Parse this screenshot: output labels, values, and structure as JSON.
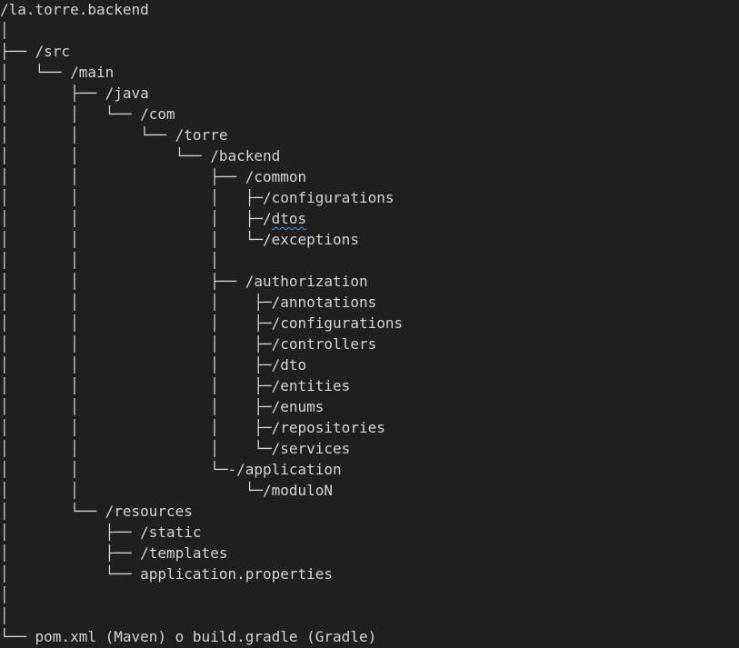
{
  "tree_lines": [
    "/la.torre.backend",
    "│",
    "├── /src",
    "│   └── /main",
    "│       ├── /java",
    "│       │   └── /com",
    "│       │       └── /torre",
    "│       │           └── /backend",
    "│       │               ├── /common",
    "│       │               │   ├─/configurations",
    "│       │               │   ├─/dtos",
    "│       │               │   └─/exceptions",
    "│       │               │",
    "│       │               ├── /authorization",
    "│       │               │    ├─/annotations",
    "│       │               │    ├─/configurations",
    "│       │               │    ├─/controllers",
    "│       │               │    ├─/dto",
    "│       │               │    ├─/entities",
    "│       │               │    ├─/enums",
    "│       │               │    ├─/repositories",
    "│       │               │    └─/services",
    "│       │               └─-/application",
    "│       │                   └─/moduloN",
    "│       └── /resources",
    "│           ├── /static",
    "│           ├── /templates",
    "│           └── application.properties",
    "│",
    "│",
    "└── pom.xml (Maven) o build.gradle (Gradle)"
  ],
  "spellcheck_flag_line": 10,
  "spellcheck_word": "dtos"
}
